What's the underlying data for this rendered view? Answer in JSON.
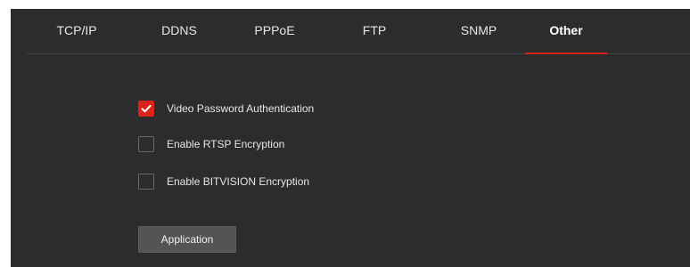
{
  "colors": {
    "panel_bg": "#2c2c2c",
    "accent": "#d9241c",
    "divider": "#444444",
    "button_bg": "#545454"
  },
  "tabs": [
    {
      "label": "TCP/IP",
      "active": false
    },
    {
      "label": "DDNS",
      "active": false
    },
    {
      "label": "PPPoE",
      "active": false
    },
    {
      "label": "FTP",
      "active": false
    },
    {
      "label": "SNMP",
      "active": false
    },
    {
      "label": "Other",
      "active": true
    }
  ],
  "options": [
    {
      "label": "Video Password Authentication",
      "checked": true,
      "icon": "checkmark-icon"
    },
    {
      "label": "Enable RTSP Encryption",
      "checked": false
    },
    {
      "label": "Enable BITVISION Encryption",
      "checked": false
    }
  ],
  "apply_button": {
    "label": "Application"
  }
}
